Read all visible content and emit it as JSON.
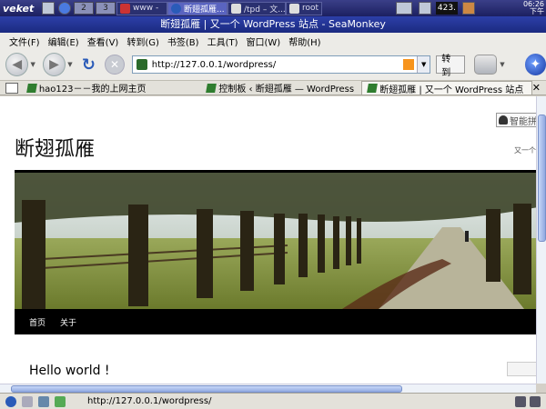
{
  "taskbar": {
    "logo": "veket",
    "workspaces": [
      "2",
      "3"
    ],
    "tasks": [
      {
        "label": "www -"
      },
      {
        "label": "断翅孤雁..."
      },
      {
        "label": "/tpd – 文..."
      },
      {
        "label": "root"
      }
    ],
    "indicator": "423.",
    "clock_time": "06:26",
    "clock_period": "下午"
  },
  "window": {
    "title": "断翅孤雁 | 又一个 WordPress 站点 - SeaMonkey"
  },
  "menu": [
    "文件(F)",
    "编辑(E)",
    "查看(V)",
    "转到(G)",
    "书签(B)",
    "工具(T)",
    "窗口(W)",
    "帮助(H)"
  ],
  "nav": {
    "url": "http://127.0.0.1/wordpress/",
    "go_label": "转到"
  },
  "tabs": [
    {
      "label": "hao123－－我的上网主页"
    },
    {
      "label": "控制板 ‹ 断翅孤雁 — WordPress"
    },
    {
      "label": "断翅孤雁 | 又一个 WordPress 站点"
    }
  ],
  "page": {
    "pinyin_label": "智能拼音",
    "site_title": "断翅孤雁",
    "site_description": "又一个",
    "menu": [
      "首页",
      "关于"
    ],
    "post_title": "Hello world !"
  },
  "status": {
    "url": "http://127.0.0.1/wordpress/"
  }
}
